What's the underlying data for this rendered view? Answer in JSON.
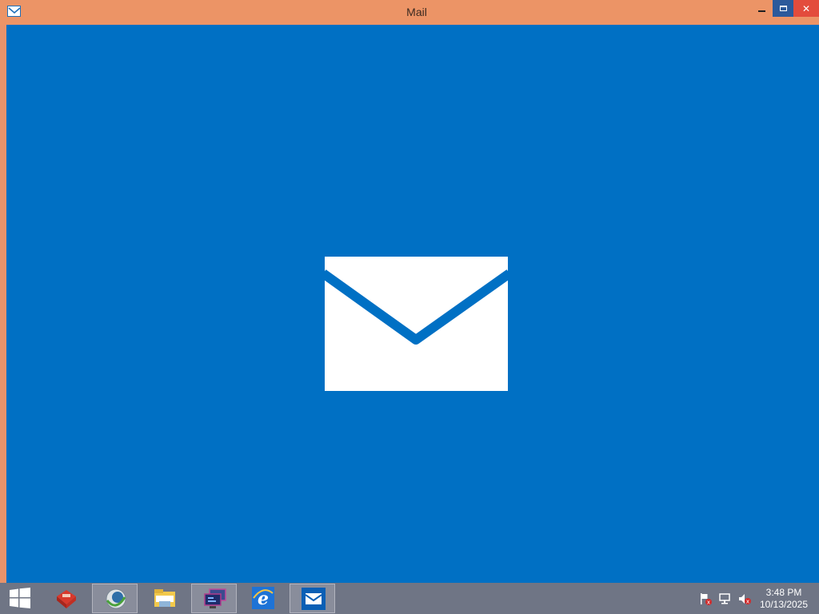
{
  "window": {
    "title": "Mail",
    "app_icon": "mail-icon",
    "controls": {
      "minimize_icon": "minimize-icon",
      "maximize_icon": "maximize-icon",
      "close_glyph": "✕"
    }
  },
  "splash": {
    "logo_icon": "mail-envelope-icon",
    "background_color": "#0070c4"
  },
  "taskbar": {
    "start_icon": "windows-logo-icon",
    "pinned": [
      {
        "icon": "toolbox-app-icon",
        "active": false
      },
      {
        "icon": "network-globe-icon",
        "active": true
      },
      {
        "icon": "file-explorer-icon",
        "active": false
      },
      {
        "icon": "remote-desktop-icon",
        "active": true
      },
      {
        "icon": "internet-explorer-icon",
        "active": false
      },
      {
        "icon": "mail-app-icon",
        "active": true
      }
    ],
    "tray": [
      "action-center-flag-icon",
      "network-icon",
      "volume-muted-icon"
    ],
    "clock": {
      "time": "3:48 PM",
      "date": "10/13/2025"
    }
  }
}
